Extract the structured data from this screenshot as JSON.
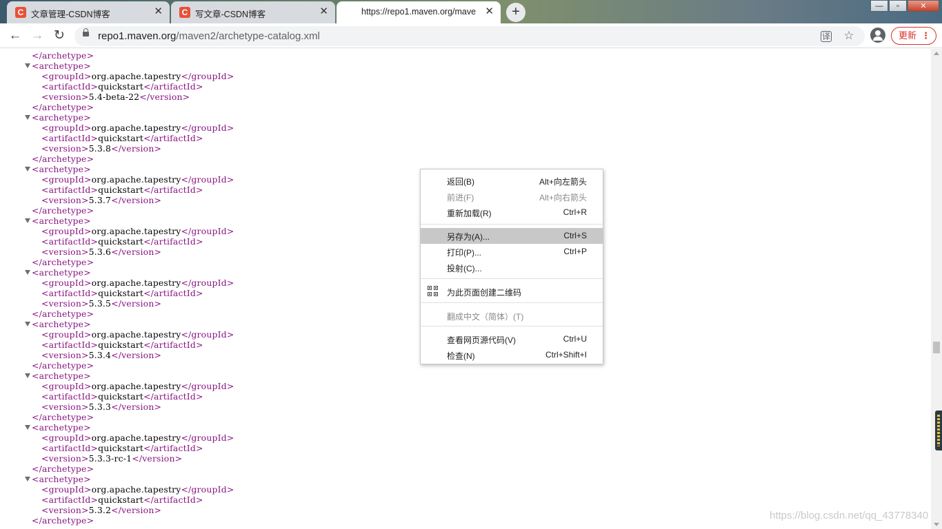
{
  "tabs": [
    {
      "title": "文章管理-CSDN博客",
      "favicon": "C",
      "close": "✕"
    },
    {
      "title": "写文章-CSDN博客",
      "favicon": "C",
      "close": "✕"
    },
    {
      "title": "https://repo1.maven.org/mave",
      "close": "✕"
    }
  ],
  "new_tab": "+",
  "window_buttons": {
    "minimize": "—",
    "maximize": "▫",
    "close": "✕"
  },
  "toolbar": {
    "back": "←",
    "forward": "→",
    "reload": "↻",
    "url_host": "repo1.maven.org",
    "url_path": "/maven2/archetype-catalog.xml",
    "translate_icon": "译",
    "bookmark_icon": "☆",
    "update_label": "更新",
    "menu_dots": "⋮"
  },
  "xml": {
    "open": "<archetype>",
    "close": "</archetype>",
    "groupId_open": "<groupId>",
    "groupId_close": "</groupId>",
    "artifactId_open": "<artifactId>",
    "artifactId_close": "</artifactId>",
    "version_open": "<version>",
    "version_close": "</version>",
    "archetypes": [
      {
        "groupId": "org.apache.tapestry",
        "artifactId": "quickstart",
        "version": "5.4-beta-22"
      },
      {
        "groupId": "org.apache.tapestry",
        "artifactId": "quickstart",
        "version": "5.3.8"
      },
      {
        "groupId": "org.apache.tapestry",
        "artifactId": "quickstart",
        "version": "5.3.7"
      },
      {
        "groupId": "org.apache.tapestry",
        "artifactId": "quickstart",
        "version": "5.3.6"
      },
      {
        "groupId": "org.apache.tapestry",
        "artifactId": "quickstart",
        "version": "5.3.5"
      },
      {
        "groupId": "org.apache.tapestry",
        "artifactId": "quickstart",
        "version": "5.3.4"
      },
      {
        "groupId": "org.apache.tapestry",
        "artifactId": "quickstart",
        "version": "5.3.3"
      },
      {
        "groupId": "org.apache.tapestry",
        "artifactId": "quickstart",
        "version": "5.3.3-rc-1"
      },
      {
        "groupId": "org.apache.tapestry",
        "artifactId": "quickstart",
        "version": "5.3.2"
      }
    ]
  },
  "context_menu": {
    "items": [
      {
        "label": "返回(B)",
        "shortcut": "Alt+向左箭头",
        "disabled": false
      },
      {
        "label": "前进(F)",
        "shortcut": "Alt+向右箭头",
        "disabled": true
      },
      {
        "label": "重新加载(R)",
        "shortcut": "Ctrl+R",
        "disabled": false
      },
      {
        "label": "另存为(A)...",
        "shortcut": "Ctrl+S",
        "disabled": false,
        "highlighted": true
      },
      {
        "label": "打印(P)...",
        "shortcut": "Ctrl+P",
        "disabled": false
      },
      {
        "label": "投射(C)...",
        "shortcut": "",
        "disabled": false
      },
      {
        "label": "为此页面创建二维码",
        "shortcut": "",
        "disabled": false,
        "icon": "qr-code-icon"
      },
      {
        "label": "翻成中文（简体）(T)",
        "shortcut": "",
        "disabled": true
      },
      {
        "label": "查看网页源代码(V)",
        "shortcut": "Ctrl+U",
        "disabled": false
      },
      {
        "label": "检查(N)",
        "shortcut": "Ctrl+Shift+I",
        "disabled": false
      }
    ]
  },
  "watermark": "https://blog.csdn.net/qq_43778340",
  "colors": {
    "xml_tag": "#881280",
    "csdn_brand": "#e8503a",
    "update_red": "#d93025",
    "menu_highlight": "#c8c8c8"
  }
}
